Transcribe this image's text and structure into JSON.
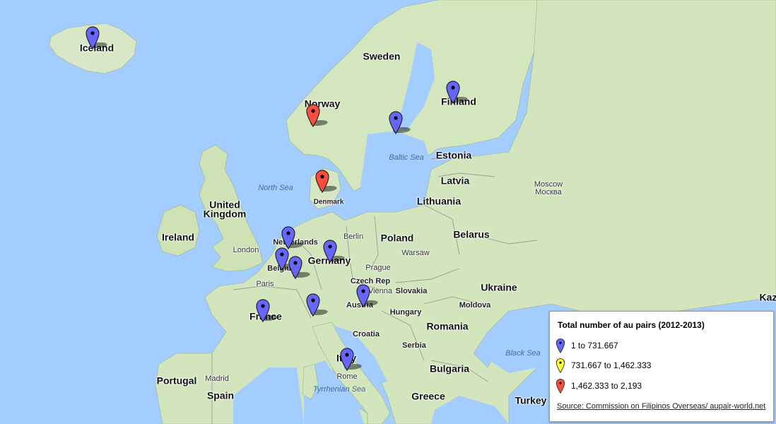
{
  "map": {
    "colors": {
      "water": "#a3ccff",
      "land": "#e8ecd8",
      "vegetation": "#cde6b4",
      "border": "#8a8a8a"
    },
    "countries": [
      "Iceland",
      "Sweden",
      "Norway",
      "Finland",
      "Estonia",
      "Latvia",
      "Lithuania",
      "Denmark",
      "United Kingdom",
      "Ireland",
      "Netherlands",
      "Belgium",
      "Germany",
      "Poland",
      "Belarus",
      "France",
      "Czech Rep",
      "Slovakia",
      "Austria",
      "Ukraine",
      "Hungary",
      "Moldova",
      "Romania",
      "Croatia",
      "Serbia",
      "Italy",
      "Bulgaria",
      "Portugal",
      "Spain",
      "Greece",
      "Turkey",
      "Kaz"
    ],
    "cities": [
      "Moscow",
      "Москва",
      "London",
      "Berlin",
      "Warsaw",
      "Prague",
      "Paris",
      "Vienna",
      "Madrid",
      "Rome"
    ],
    "seas": [
      "North Sea",
      "Baltic Sea",
      "Black Sea",
      "Tyrrhenian Sea"
    ],
    "markers": [
      {
        "country": "Iceland",
        "color": "blue"
      },
      {
        "country": "Finland",
        "color": "blue"
      },
      {
        "country": "Sweden",
        "color": "blue"
      },
      {
        "country": "Norway",
        "color": "red"
      },
      {
        "country": "Denmark",
        "color": "red"
      },
      {
        "country": "Netherlands",
        "color": "blue"
      },
      {
        "country": "Belgium",
        "color": "blue"
      },
      {
        "country": "Luxembourg",
        "color": "blue"
      },
      {
        "country": "Germany",
        "color": "blue"
      },
      {
        "country": "Switzerland",
        "color": "blue"
      },
      {
        "country": "Austria",
        "color": "blue"
      },
      {
        "country": "France",
        "color": "blue"
      },
      {
        "country": "Italy",
        "color": "blue"
      }
    ]
  },
  "legend": {
    "title": "Total number of au pairs (2012-2013)",
    "items": [
      {
        "label": "1 to 731.667",
        "color": "#6666ff"
      },
      {
        "label": "731.667 to 1,462.333",
        "color": "#ffff33"
      },
      {
        "label": "1,462.333 to 2,193",
        "color": "#ff4d3d"
      }
    ],
    "source": "Source: Commission on Filipinos Overseas/ aupair-world.net"
  }
}
